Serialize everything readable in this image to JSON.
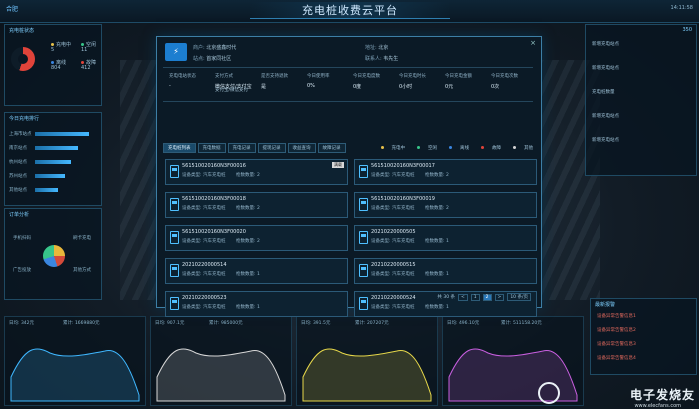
{
  "header": {
    "logo_text": "合肥",
    "title": "充电桩收费云平台",
    "time": "14:11:58"
  },
  "left": {
    "panel1_title": "充电桩状态",
    "stats": [
      {
        "label": "充电中",
        "value": "5"
      },
      {
        "label": "空闲",
        "value": "11"
      },
      {
        "label": "离线",
        "value": "8"
      },
      {
        "label": "故障",
        "value": "5"
      },
      {
        "label": "",
        "value": "804"
      },
      {
        "label": "",
        "value": "412"
      }
    ],
    "panel2_title": "今日充电排行",
    "bars": [
      {
        "label": "上海市站点",
        "value": 0.9
      },
      {
        "label": "南京站点",
        "value": 0.72
      },
      {
        "label": "杭州站点",
        "value": 0.6
      },
      {
        "label": "苏州站点",
        "value": 0.5
      },
      {
        "label": "其他站点",
        "value": 0.38
      }
    ],
    "panel3_title": "订单分析",
    "pie_labels": [
      "手机扫码",
      "刷卡充电",
      "广告投放",
      "其他方式"
    ]
  },
  "charts": [
    {
      "label": "日均: 342元",
      "sub": "累计: 1669880元",
      "color": "#3fb7ff"
    },
    {
      "label": "日均: 907.1元",
      "sub": "累计: 985000元",
      "color": "#d7d7d7"
    },
    {
      "label": "日均: 391.5元",
      "sub": "累计: 207207元",
      "color": "#e7d84a"
    },
    {
      "label": "日均: 496.10元",
      "sub": "累计: 511158.20元",
      "color": "#c95fe0"
    }
  ],
  "right": {
    "top_value": "350",
    "items": [
      "新增充电站点",
      "新增充电站点",
      "充电桩数量",
      "新增充电站点",
      "新增充电站点"
    ],
    "panel_title": "最新报警",
    "alerts": [
      "设备异常告警信息1",
      "设备异常告警信息2",
      "设备异常告警信息3",
      "设备异常告警信息4"
    ]
  },
  "modal": {
    "logo": "⚡",
    "operator_k": "商户:",
    "operator_v": "北京盛鑫时代",
    "region_k": "地址:",
    "region_v": "北京",
    "site_k": "站点:",
    "site_v": "首家同社区",
    "contact_k": "联系人:",
    "contact_v": "韦先生",
    "summary": [
      {
        "k": "充电电站状态",
        "v": "-"
      },
      {
        "k": "支付方式",
        "v": "微信支付/支付宝"
      },
      {
        "k": "是否支持退款",
        "v": "是"
      },
      {
        "k": "今日使用率",
        "v": "0%"
      },
      {
        "k": "今日充电度数",
        "v": "0度"
      },
      {
        "k": "今日充电时长",
        "v": "0小时"
      },
      {
        "k": "今日充电金额",
        "v": "0元"
      },
      {
        "k": "今日充电次数",
        "v": "0次"
      }
    ],
    "summary_extra": "支付宝/微信支付",
    "tabs": [
      "充电桩列表",
      "充电数据",
      "充电记录",
      "提现记录",
      "收益查询",
      "故障记录"
    ],
    "legend": [
      {
        "label": "充电中",
        "color": "#e7c14a"
      },
      {
        "label": "空闲",
        "color": "#37c58a"
      },
      {
        "label": "离线",
        "color": "#3a86e0"
      },
      {
        "label": "故障",
        "color": "#e0433a"
      },
      {
        "label": "其他",
        "color": "#d3d3d3"
      }
    ],
    "cards": [
      {
        "id": "561510020160N3F00016",
        "type": "设备类型: 汽车充电桩",
        "guns": "枪数数量: 2",
        "badge": "满载"
      },
      {
        "id": "561510020160N3F00017",
        "type": "设备类型: 汽车充电桩",
        "guns": "枪数数量: 2",
        "badge": ""
      },
      {
        "id": "561510020160N3F00018",
        "type": "设备类型: 汽车充电桩",
        "guns": "枪数数量: 2",
        "badge": ""
      },
      {
        "id": "561510020160N3F00019",
        "type": "设备类型: 汽车充电桩",
        "guns": "枪数数量: 2",
        "badge": ""
      },
      {
        "id": "561510020160N3F00020",
        "type": "设备类型: 汽车充电桩",
        "guns": "枪数数量: 2",
        "badge": ""
      },
      {
        "id": "20210220000505",
        "type": "设备类型: 汽车充电桩",
        "guns": "枪数数量: 1",
        "badge": ""
      },
      {
        "id": "20210220000514",
        "type": "设备类型: 汽车充电桩",
        "guns": "枪数数量: 1",
        "badge": ""
      },
      {
        "id": "20210220000515",
        "type": "设备类型: 汽车充电桩",
        "guns": "枪数数量: 1",
        "badge": ""
      },
      {
        "id": "20210220000523",
        "type": "设备类型: 汽车充电桩",
        "guns": "枪数数量: 1",
        "badge": ""
      },
      {
        "id": "20210220000524",
        "type": "设备类型: 汽车充电桩",
        "guns": "枪数数量: 1",
        "badge": ""
      }
    ],
    "pager": {
      "total": "共 30 条",
      "prev": "<",
      "pages": [
        "1",
        "2"
      ],
      "next": ">",
      "size": "10 条/页"
    }
  },
  "watermark": {
    "brand": "电子发烧友",
    "url": "www.elecfans.com"
  }
}
